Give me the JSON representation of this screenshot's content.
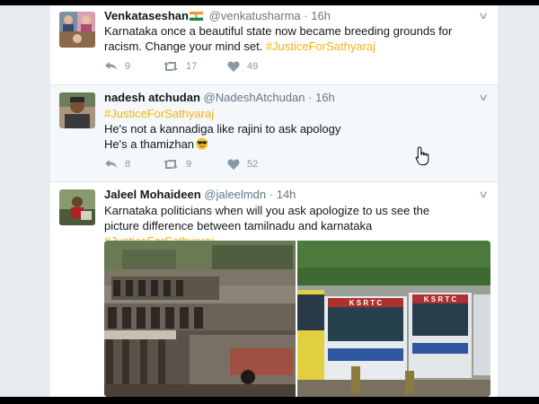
{
  "tweets": [
    {
      "name": "Venkataseshan",
      "handle": "@venkatusharma",
      "time": "16h",
      "text_plain": "Karnataka once a beautiful state now became breeding grounds for racism. Change your mind set.",
      "hashtag": "#JusticeForSathyaraj",
      "replies": "9",
      "retweets": "17",
      "likes": "49"
    },
    {
      "name": "nadesh atchudan",
      "handle": "@NadeshAtchudan",
      "time": "16h",
      "hashtag": "#JusticeForSathyaraj",
      "line2": "He's not a kannadiga like rajini to ask apology",
      "line3": "He's a thamizhan",
      "replies": "8",
      "retweets": "9",
      "likes": "52"
    },
    {
      "name": "Jaleel Mohaideen",
      "handle": "@jaleelmdn",
      "time": "14h",
      "text_plain": "Karnataka politicians when will you ask apologize to us see the picture difference between tamilnadu and karnataka",
      "hashtag": "#JusticeForSathyaraj"
    }
  ],
  "separator": "·",
  "bus_sign": "K S R T C",
  "colors": {
    "hashtag": "#f7b20f",
    "text": "#14171a",
    "muted": "#657786",
    "icon": "#8899a6",
    "background": "#e6ecf0"
  },
  "icons": [
    "reply-icon",
    "retweet-icon",
    "like-icon",
    "chevron-down-icon",
    "india-flag-icon",
    "sunglasses-emoji-icon",
    "hand-cursor-icon"
  ]
}
